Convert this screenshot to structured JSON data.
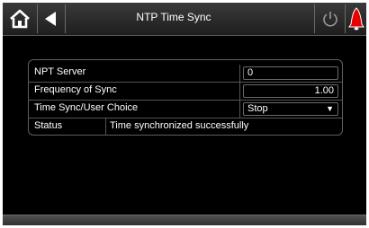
{
  "header": {
    "title": "NTP Time Sync",
    "icons": [
      "home-icon",
      "back-arrow-icon",
      "power-icon",
      "alarm-bell-icon"
    ]
  },
  "settings": {
    "ntp_server_label": "NPT Server",
    "ntp_server_value": "0",
    "frequency_label": "Frequency of Sync",
    "frequency_value": "1.00",
    "choice_label": "Time Sync/User Choice",
    "choice_value": "Stop",
    "status_label": "Status",
    "status_value": "Time synchronized successfully"
  },
  "colors": {
    "background": "#000000",
    "alarm": "#e60000",
    "text": "#ffffff"
  }
}
